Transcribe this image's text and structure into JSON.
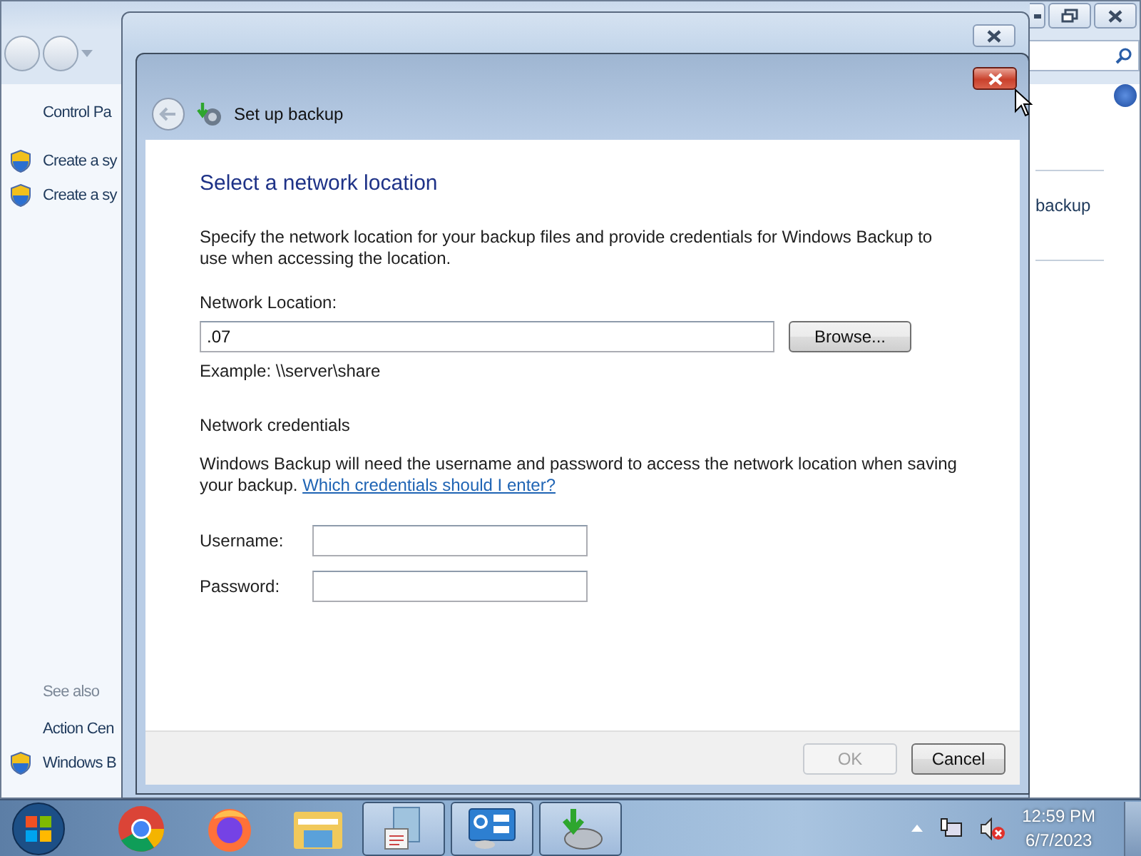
{
  "background_window": {
    "left_pane": {
      "title": "Control Pa",
      "tasks": [
        {
          "label": "Create a sy"
        },
        {
          "label": "Create a sy"
        }
      ],
      "see_also_heading": "See also",
      "see_also": [
        {
          "label": "Action Cen",
          "shield": false
        },
        {
          "label": "Windows B",
          "shield": true
        }
      ]
    },
    "right_pane": {
      "link": "backup"
    }
  },
  "dialog": {
    "title": "Set up backup",
    "heading": "Select a network location",
    "description": "Specify the network location for your backup files and provide credentials for Windows Backup to use when accessing the location.",
    "location_label": "Network Location:",
    "location_value": ".07",
    "browse_button": "Browse...",
    "example": "Example: \\\\server\\share",
    "credentials_heading": "Network credentials",
    "credentials_text": "Windows Backup will need the username and password to access the network location when saving your backup.",
    "credentials_link": "Which credentials should I enter?",
    "fields": [
      {
        "label": "Username:"
      },
      {
        "label": "Password:"
      }
    ],
    "buttons": [
      {
        "label": "OK",
        "disabled": true
      },
      {
        "label": "Cancel",
        "disabled": false
      }
    ]
  },
  "taskbar": {
    "apps": [
      {
        "kind": "chrome",
        "running": false
      },
      {
        "kind": "firefox",
        "running": false
      },
      {
        "kind": "folder",
        "running": false
      },
      {
        "kind": "document",
        "running": true
      },
      {
        "kind": "panel",
        "running": true
      },
      {
        "kind": "backup",
        "running": true
      }
    ],
    "clock": {
      "time": "12:59 PM",
      "date": "6/7/2023"
    }
  }
}
